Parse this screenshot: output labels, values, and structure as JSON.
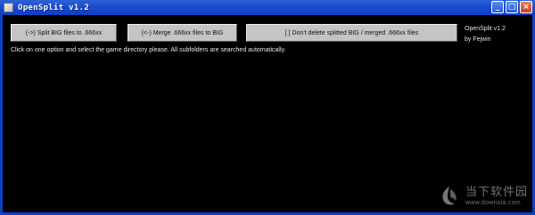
{
  "window": {
    "title": "OpenSplit v1.2"
  },
  "titlebar_buttons": {
    "minimize": "_",
    "maximize": "□",
    "close": "×"
  },
  "buttons": {
    "split_label": "(->) Split BIG files to .666xx",
    "merge_label": "(<-) Merge .666xx files to BIG",
    "nodelete_label": "[   ] Don't delete splitted BIG / merged .666xx files"
  },
  "info": {
    "version": "OpenSplit v1.2",
    "author": "by Fejwin"
  },
  "status": {
    "text": "Click on one option and select the game directory please. All subfolders are searched automatically."
  },
  "watermark": {
    "name": "当下软件园",
    "url": "www.downxia.com"
  },
  "colors": {
    "titlebar": "#1a4ccf",
    "background": "#000000",
    "button_face": "#c4c4c4"
  }
}
